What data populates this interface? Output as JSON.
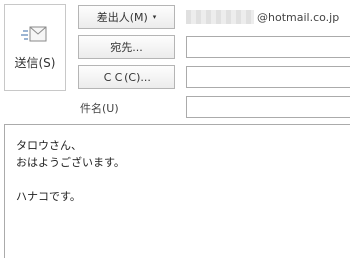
{
  "send": {
    "label": "送信(S)",
    "icon": "send-envelope-icon"
  },
  "header": {
    "from_button": "差出人(M)",
    "from_caret": "▾",
    "from_address_domain": "@hotmail.co.jp",
    "to_button": "宛先...",
    "cc_button": "ＣＣ(C)...",
    "subject_label": "件名(U)"
  },
  "fields": {
    "to_value": "",
    "cc_value": "",
    "subject_value": ""
  },
  "body": {
    "lines": [
      "タロウさん、",
      "おはようございます。",
      "",
      "ハナコです。"
    ]
  }
}
